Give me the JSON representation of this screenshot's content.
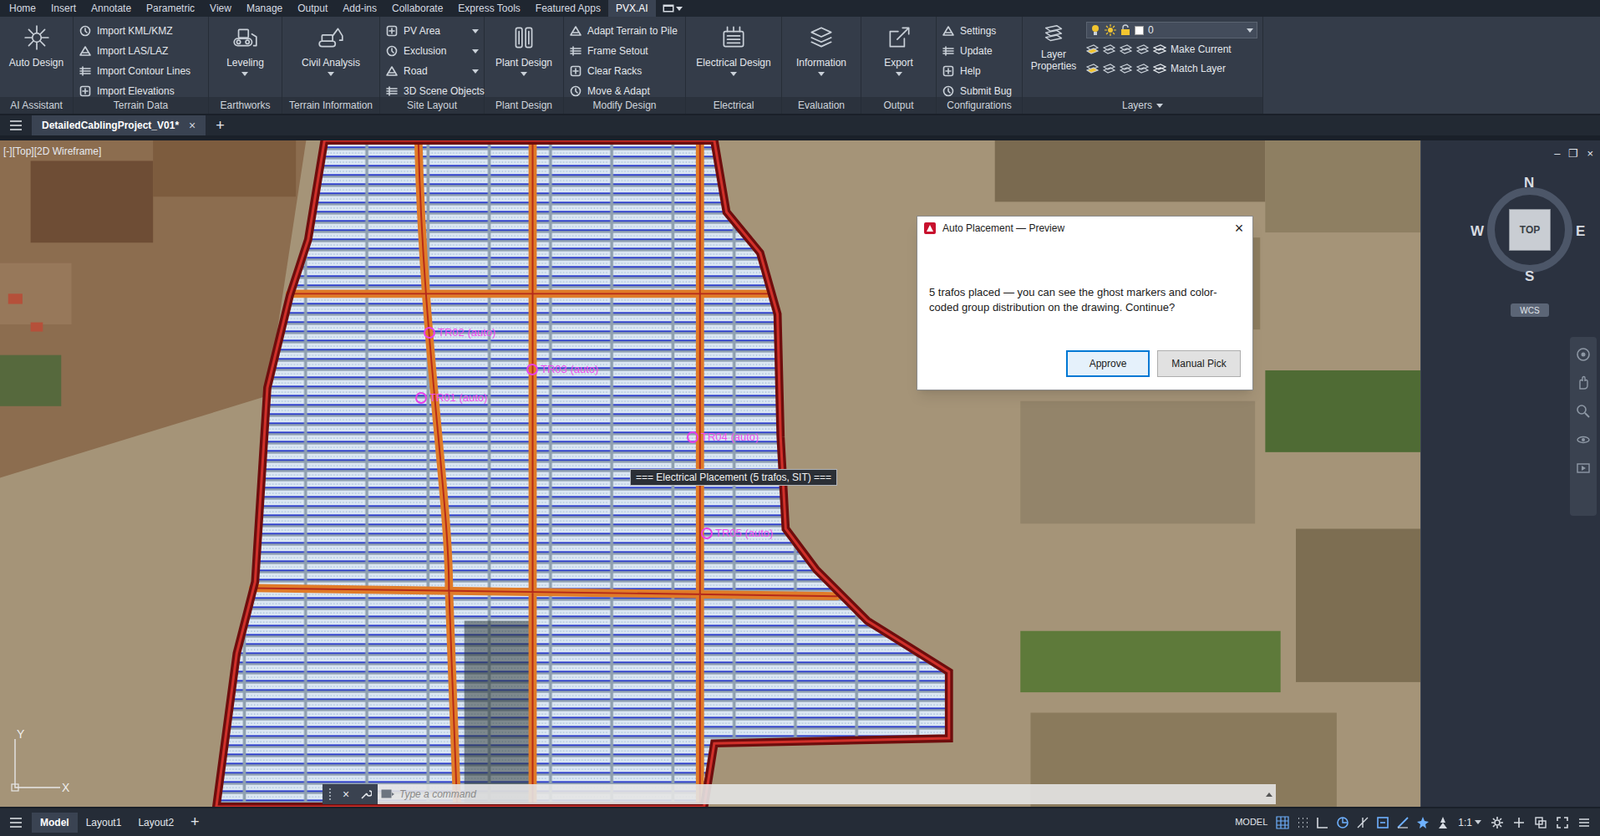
{
  "menu_tabs": [
    {
      "label": "Home",
      "selected": false
    },
    {
      "label": "Insert",
      "selected": false
    },
    {
      "label": "Annotate",
      "selected": false
    },
    {
      "label": "Parametric",
      "selected": false
    },
    {
      "label": "View",
      "selected": false
    },
    {
      "label": "Manage",
      "selected": false
    },
    {
      "label": "Output",
      "selected": false
    },
    {
      "label": "Add-ins",
      "selected": false
    },
    {
      "label": "Collaborate",
      "selected": false
    },
    {
      "label": "Express Tools",
      "selected": false
    },
    {
      "label": "Featured Apps",
      "selected": false
    },
    {
      "label": "PVX.AI",
      "selected": true
    }
  ],
  "ribbon": {
    "panels": [
      {
        "title": "AI Assistant",
        "kind": "big",
        "buttons": [
          {
            "label": "Auto Design",
            "dropdown": false
          }
        ]
      },
      {
        "title": "Terrain Data",
        "kind": "small",
        "buttons": [
          {
            "label": "Import KML/KMZ",
            "dropdown": false
          },
          {
            "label": "Import LAS/LAZ",
            "dropdown": false
          },
          {
            "label": "Import Contour Lines",
            "dropdown": false
          },
          {
            "label": "Import Elevations",
            "dropdown": false
          }
        ]
      },
      {
        "title": "Earthworks",
        "kind": "big",
        "buttons": [
          {
            "label": "Leveling",
            "dropdown": true
          }
        ]
      },
      {
        "title": "Terrain Information",
        "kind": "big",
        "buttons": [
          {
            "label": "Civil Analysis",
            "dropdown": true
          }
        ]
      },
      {
        "title": "Site Layout",
        "kind": "small",
        "buttons": [
          {
            "label": "PV Area",
            "dropdown": true
          },
          {
            "label": "Exclusion",
            "dropdown": true
          },
          {
            "label": "Road",
            "dropdown": true
          },
          {
            "label": "3D Scene Objects",
            "dropdown": false
          }
        ]
      },
      {
        "title": "Plant Design",
        "kind": "big",
        "buttons": [
          {
            "label": "Plant Design",
            "dropdown": true
          }
        ]
      },
      {
        "title": "Modify Design",
        "kind": "small",
        "buttons": [
          {
            "label": "Adapt Terrain to Pile",
            "dropdown": false
          },
          {
            "label": "Frame Setout",
            "dropdown": false
          },
          {
            "label": "Clear Racks",
            "dropdown": false
          },
          {
            "label": "Move & Adapt",
            "dropdown": false
          }
        ]
      },
      {
        "title": "Electrical",
        "kind": "big",
        "buttons": [
          {
            "label": "Electrical Design",
            "dropdown": true
          }
        ]
      },
      {
        "title": "Evaluation",
        "kind": "big",
        "buttons": [
          {
            "label": "Information",
            "dropdown": true
          }
        ]
      },
      {
        "title": "Output",
        "kind": "big",
        "buttons": [
          {
            "label": "Export",
            "dropdown": true
          }
        ]
      },
      {
        "title": "Configurations",
        "kind": "small",
        "buttons": [
          {
            "label": "Settings",
            "dropdown": false
          },
          {
            "label": "Update",
            "dropdown": false
          },
          {
            "label": "Help",
            "dropdown": false
          },
          {
            "label": "Submit Bug",
            "dropdown": false
          }
        ]
      },
      {
        "title": "Layers",
        "kind": "layers",
        "title_dropdown": true,
        "buttons": [
          {
            "label": "Layer Properties",
            "dropdown": false
          }
        ],
        "current_layer": "0",
        "actions": [
          "Make Current",
          "Match Layer"
        ]
      }
    ]
  },
  "document_tabs": [
    {
      "label": "DetailedCablingProject_V01*",
      "selected": true,
      "close": "×"
    }
  ],
  "new_tab": "+",
  "viewport": {
    "label": "[-][Top][2D Wireframe]",
    "transformers": [
      {
        "label": "TR02 (auto)"
      },
      {
        "label": "TR03 (auto)"
      },
      {
        "label": "TR01 (auto)"
      },
      {
        "label": "TR04 (auto)"
      },
      {
        "label": "TR05 (auto)"
      }
    ],
    "tooltip": "=== Electrical Placement (5 trafos, SIT) ===",
    "ucs": {
      "x": "X",
      "y": "Y"
    }
  },
  "view_controls": {
    "window_buttons": [
      "–",
      "❐",
      "×"
    ],
    "compass": {
      "n": "N",
      "s": "S",
      "w": "W",
      "e": "E"
    },
    "cube_face": "TOP",
    "coordinate_system": "WCS"
  },
  "dialog": {
    "title": "Auto Placement — Preview",
    "close": "×",
    "message": "5 trafos placed — you can see the ghost markers and color-coded group distribution on the drawing. Continue?",
    "buttons": [
      {
        "label": "Approve",
        "selected": true
      },
      {
        "label": "Manual Pick",
        "selected": false
      }
    ]
  },
  "command_line": {
    "placeholder": "Type a command",
    "close": "×"
  },
  "status_bar": {
    "layout_tabs": [
      {
        "label": "Model",
        "selected": true
      },
      {
        "label": "Layout1",
        "selected": false
      },
      {
        "label": "Layout2",
        "selected": false
      }
    ],
    "add": "+",
    "space": "MODEL",
    "scale": "1:1"
  }
}
